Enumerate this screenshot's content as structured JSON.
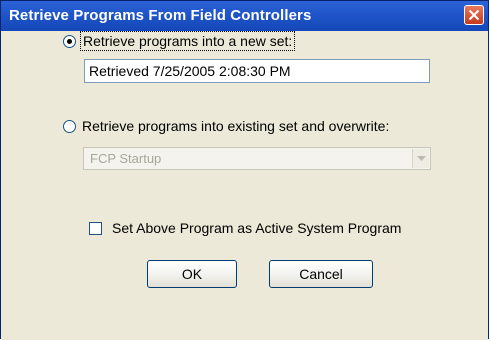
{
  "window": {
    "title": "Retrieve Programs From Field Controllers",
    "close_icon": "close-icon"
  },
  "options": {
    "new_set": {
      "label": "Retrieve programs into a new set:",
      "selected": true,
      "name_value": "Retrieved 7/25/2005 2:08:30 PM"
    },
    "existing_set": {
      "label": "Retrieve programs into existing set and overwrite:",
      "selected": false,
      "dropdown_value": "FCP Startup",
      "dropdown_enabled": false
    }
  },
  "active_program": {
    "label": "Set Above Program as Active System Program",
    "checked": false
  },
  "buttons": {
    "ok_label": "OK",
    "cancel_label": "Cancel"
  },
  "colors": {
    "titlebar": "#1f55c9",
    "dialog_bg": "#ece9d8",
    "close_button": "#c8391c"
  }
}
